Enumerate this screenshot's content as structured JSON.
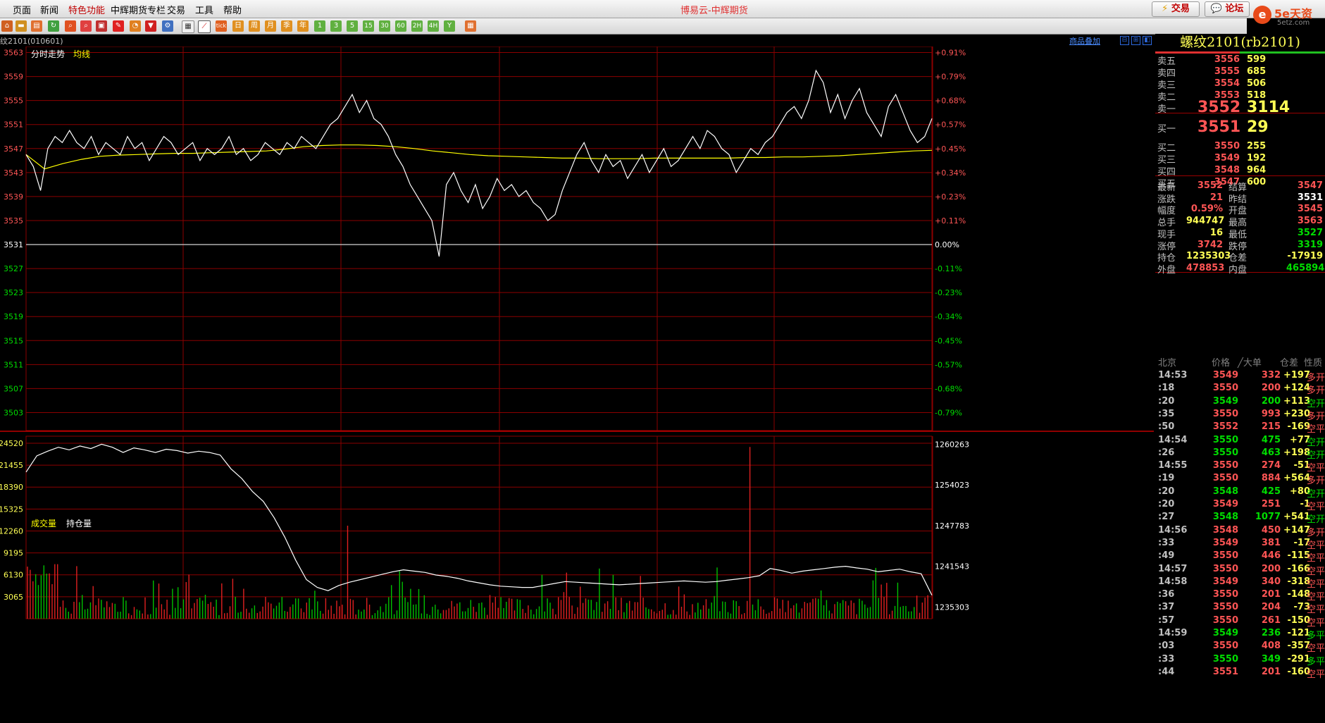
{
  "menubar": {
    "items": [
      "页面",
      "新闻",
      "特色功能",
      "中辉期货专栏",
      "交易",
      "工具",
      "帮助"
    ],
    "title": "博易云-中辉期货",
    "trade_button": "交易",
    "forum_button": "论坛",
    "logo_text": "5e天资",
    "logo_sub": "5etz.com"
  },
  "toolbar": {
    "icons": [
      "home-icon",
      "tag-icon",
      "book-icon",
      "refresh-icon",
      "search-icon",
      "zoom-out-icon",
      "window-icon",
      "pencil-icon",
      "palette-icon",
      "filter-icon",
      "settings-icon",
      "table-icon",
      "timeshare-icon",
      "tick-icon",
      "daily-icon",
      "weekly-icon",
      "monthly-icon",
      "quarterly-icon",
      "yearly-icon",
      "period-1-icon",
      "period-3-icon",
      "period-5-icon",
      "period-15-icon",
      "period-30-icon",
      "period-60-icon",
      "period-2h-icon",
      "period-4h-icon",
      "period-y-icon",
      "calendar-icon"
    ],
    "period_labels": [
      "tick",
      "日",
      "周",
      "月",
      "季",
      "年",
      "1",
      "3",
      "5",
      "15",
      "30",
      "60",
      "2H",
      "4H",
      "Y"
    ]
  },
  "chart_header": {
    "symbol_code": "纹2101(010601)",
    "overlay_link": "商品叠加",
    "price_title": "分时走势",
    "avg_title": "均线",
    "volume_title": "成交量",
    "oi_title": "持仓量"
  },
  "chart_data": [
    {
      "type": "line",
      "title": "分时走势",
      "series": [
        {
          "name": "分时走势",
          "color": "#ffffff"
        },
        {
          "name": "均线",
          "color": "#ffff00"
        }
      ],
      "reference_price": 3531,
      "ylim": [
        3500,
        3564
      ],
      "y_ticks": [
        3563,
        3559,
        3555,
        3551,
        3547,
        3543,
        3539,
        3535,
        3531,
        3527,
        3523,
        3519,
        3515,
        3511,
        3507,
        3503
      ],
      "pct_ticks": [
        "+0.91%",
        "+0.79%",
        "+0.68%",
        "+0.57%",
        "+0.45%",
        "+0.34%",
        "+0.23%",
        "+0.11%",
        "0.00%",
        "-0.11%",
        "-0.23%",
        "-0.34%",
        "-0.45%",
        "-0.57%",
        "-0.68%",
        "-0.79%"
      ],
      "price_values": [
        3546,
        3544,
        3540,
        3547,
        3549,
        3548,
        3550,
        3548,
        3547,
        3549,
        3546,
        3548,
        3547,
        3546,
        3549,
        3547,
        3548,
        3545,
        3547,
        3549,
        3548,
        3546,
        3547,
        3548,
        3545,
        3547,
        3546,
        3547,
        3549,
        3546,
        3547,
        3545,
        3546,
        3548,
        3547,
        3546,
        3548,
        3547,
        3549,
        3548,
        3547,
        3549,
        3551,
        3552,
        3554,
        3556,
        3553,
        3555,
        3552,
        3551,
        3549,
        3546,
        3544,
        3541,
        3539,
        3537,
        3535,
        3529,
        3541,
        3543,
        3540,
        3538,
        3541,
        3537,
        3539,
        3542,
        3540,
        3541,
        3539,
        3540,
        3538,
        3537,
        3535,
        3536,
        3540,
        3543,
        3546,
        3548,
        3545,
        3543,
        3546,
        3544,
        3545,
        3542,
        3544,
        3546,
        3543,
        3545,
        3547,
        3544,
        3545,
        3547,
        3549,
        3547,
        3550,
        3549,
        3547,
        3546,
        3543,
        3545,
        3547,
        3546,
        3548,
        3549,
        3551,
        3553,
        3554,
        3552,
        3555,
        3560,
        3558,
        3553,
        3556,
        3552,
        3555,
        3557,
        3553,
        3551,
        3549,
        3554,
        3556,
        3553,
        3550,
        3548,
        3549,
        3552
      ],
      "avg_values": [
        3546,
        3543.6,
        3544.5,
        3545.2,
        3545.7,
        3545.9,
        3546.0,
        3546.1,
        3546.2,
        3546.2,
        3546.3,
        3546.4,
        3546.5,
        3546.6,
        3546.9,
        3547.3,
        3547.5,
        3547.6,
        3547.6,
        3547.5,
        3547.3,
        3547.0,
        3546.6,
        3546.3,
        3546.0,
        3545.8,
        3545.7,
        3545.6,
        3545.5,
        3545.4,
        3545.4,
        3545.3,
        3545.3,
        3545.3,
        3545.4,
        3545.4,
        3545.4,
        3545.4,
        3545.4,
        3545.5,
        3545.5,
        3545.6,
        3545.6,
        3545.7,
        3545.8,
        3546.0,
        3546.2,
        3546.4,
        3546.6,
        3546.7
      ],
      "volume_axis": {
        "ylim": [
          0,
          25500
        ],
        "ticks": [
          24520,
          21455,
          18390,
          15325,
          12260,
          9195,
          6130,
          3065
        ]
      },
      "oi_axis": {
        "ylim": [
          1233500,
          1261500
        ],
        "ticks": [
          1260263,
          1254023,
          1247783,
          1241543,
          1235303
        ]
      },
      "oi_values": [
        1256000,
        1258500,
        1259200,
        1259800,
        1259400,
        1260000,
        1259600,
        1260263,
        1259800,
        1259000,
        1259700,
        1259400,
        1259000,
        1259500,
        1259300,
        1258900,
        1259200,
        1259000,
        1258600,
        1256500,
        1255000,
        1253000,
        1251500,
        1249000,
        1246000,
        1242500,
        1239500,
        1238300,
        1237800,
        1238600,
        1239100,
        1239500,
        1239900,
        1240300,
        1240700,
        1241000,
        1240800,
        1240600,
        1240200,
        1240000,
        1239700,
        1239300,
        1239000,
        1238700,
        1238500,
        1238400,
        1238300,
        1238300,
        1238600,
        1238900,
        1239200,
        1239100,
        1239000,
        1238900,
        1238800,
        1238700,
        1238800,
        1238900,
        1239000,
        1239100,
        1239200,
        1239300,
        1239200,
        1239100,
        1239200,
        1239400,
        1239600,
        1239800,
        1240100,
        1241200,
        1240900,
        1240500,
        1240800,
        1241000,
        1241200,
        1241400,
        1241543,
        1241300,
        1241100,
        1240700,
        1240900,
        1241100,
        1240700,
        1240400,
        1237100
      ]
    }
  ],
  "quote_panel": {
    "symbol": "螺纹2101(rb2101)",
    "asks": [
      {
        "label": "卖五",
        "price": "3556",
        "vol": "599"
      },
      {
        "label": "卖四",
        "price": "3555",
        "vol": "685"
      },
      {
        "label": "卖三",
        "price": "3554",
        "vol": "506"
      },
      {
        "label": "卖二",
        "price": "3553",
        "vol": "518"
      },
      {
        "label": "卖一",
        "price": "3552",
        "vol": "3114"
      }
    ],
    "bids": [
      {
        "label": "买一",
        "price": "3551",
        "vol": "29"
      },
      {
        "label": "买二",
        "price": "3550",
        "vol": "255"
      },
      {
        "label": "买三",
        "price": "3549",
        "vol": "192"
      },
      {
        "label": "买四",
        "price": "3548",
        "vol": "964"
      },
      {
        "label": "买五",
        "price": "3547",
        "vol": "600"
      }
    ],
    "stats": [
      {
        "k1": "最新",
        "v1": "3552",
        "c1": "#ff5555",
        "k2": "结算",
        "v2": "3547",
        "c2": "#ff5555"
      },
      {
        "k1": "涨跌",
        "v1": "21",
        "c1": "#ff5555",
        "k2": "昨结",
        "v2": "3531",
        "c2": "#ffffff"
      },
      {
        "k1": "幅度",
        "v1": "0.59%",
        "c1": "#ff5555",
        "k2": "开盘",
        "v2": "3545",
        "c2": "#ff5555"
      },
      {
        "k1": "总手",
        "v1": "944747",
        "c1": "#ffff55",
        "k2": "最高",
        "v2": "3563",
        "c2": "#ff5555"
      },
      {
        "k1": "现手",
        "v1": "16",
        "c1": "#ffff55",
        "k2": "最低",
        "v2": "3527",
        "c2": "#00dd00"
      },
      {
        "k1": "涨停",
        "v1": "3742",
        "c1": "#ff5555",
        "k2": "跌停",
        "v2": "3319",
        "c2": "#00dd00"
      },
      {
        "k1": "持仓",
        "v1": "1235303",
        "c1": "#ffff55",
        "k2": "仓差",
        "v2": "-17919",
        "c2": "#ffff55"
      },
      {
        "k1": "外盘",
        "v1": "478853",
        "c1": "#ff5555",
        "k2": "内盘",
        "v2": "465894",
        "c2": "#00dd00"
      }
    ],
    "trade_header": [
      "北京",
      "价格",
      "╱大单",
      "仓差",
      "性质"
    ],
    "trades": [
      {
        "t": "14:53",
        "p": "3549",
        "v": "332",
        "d": "+197",
        "n": "多开",
        "pc": "#ff5555",
        "nc": "#ff5555"
      },
      {
        "t": ":18",
        "p": "3550",
        "v": "200",
        "d": "+124",
        "n": "多开",
        "pc": "#ff5555",
        "nc": "#ff5555"
      },
      {
        "t": ":20",
        "p": "3549",
        "v": "200",
        "d": "+113",
        "n": "空开",
        "pc": "#00dd00",
        "nc": "#00dd00"
      },
      {
        "t": ":35",
        "p": "3550",
        "v": "993",
        "d": "+230",
        "n": "多开",
        "pc": "#ff5555",
        "nc": "#ff5555"
      },
      {
        "t": ":50",
        "p": "3552",
        "v": "215",
        "d": "-169",
        "n": "空平",
        "pc": "#ff5555",
        "nc": "#ff5555"
      },
      {
        "t": "14:54",
        "p": "3550",
        "v": "475",
        "d": "+77",
        "n": "空开",
        "pc": "#00dd00",
        "nc": "#00dd00"
      },
      {
        "t": ":26",
        "p": "3550",
        "v": "463",
        "d": "+198",
        "n": "空开",
        "pc": "#00dd00",
        "nc": "#00dd00"
      },
      {
        "t": "14:55",
        "p": "3550",
        "v": "274",
        "d": "-51",
        "n": "空平",
        "pc": "#ff5555",
        "nc": "#ff5555"
      },
      {
        "t": ":19",
        "p": "3550",
        "v": "884",
        "d": "+564",
        "n": "多开",
        "pc": "#ff5555",
        "nc": "#ff5555"
      },
      {
        "t": ":20",
        "p": "3548",
        "v": "425",
        "d": "+80",
        "n": "空开",
        "pc": "#00dd00",
        "nc": "#00dd00"
      },
      {
        "t": ":20",
        "p": "3549",
        "v": "251",
        "d": "-1",
        "n": "空平",
        "pc": "#ff5555",
        "nc": "#ff5555"
      },
      {
        "t": ":27",
        "p": "3548",
        "v": "1077",
        "d": "+541",
        "n": "空开",
        "pc": "#00dd00",
        "nc": "#00dd00"
      },
      {
        "t": "14:56",
        "p": "3548",
        "v": "450",
        "d": "+147",
        "n": "多开",
        "pc": "#ff5555",
        "nc": "#ff5555"
      },
      {
        "t": ":33",
        "p": "3549",
        "v": "381",
        "d": "-17",
        "n": "空平",
        "pc": "#ff5555",
        "nc": "#ff5555"
      },
      {
        "t": ":49",
        "p": "3550",
        "v": "446",
        "d": "-115",
        "n": "空平",
        "pc": "#ff5555",
        "nc": "#ff5555"
      },
      {
        "t": "14:57",
        "p": "3550",
        "v": "200",
        "d": "-166",
        "n": "空平",
        "pc": "#ff5555",
        "nc": "#ff5555"
      },
      {
        "t": "14:58",
        "p": "3549",
        "v": "340",
        "d": "-318",
        "n": "空平",
        "pc": "#ff5555",
        "nc": "#ff5555"
      },
      {
        "t": ":36",
        "p": "3550",
        "v": "201",
        "d": "-148",
        "n": "空平",
        "pc": "#ff5555",
        "nc": "#ff5555"
      },
      {
        "t": ":37",
        "p": "3550",
        "v": "204",
        "d": "-73",
        "n": "空平",
        "pc": "#ff5555",
        "nc": "#ff5555"
      },
      {
        "t": ":57",
        "p": "3550",
        "v": "261",
        "d": "-150",
        "n": "空平",
        "pc": "#ff5555",
        "nc": "#ff5555"
      },
      {
        "t": "14:59",
        "p": "3549",
        "v": "236",
        "d": "-121",
        "n": "多平",
        "pc": "#00dd00",
        "nc": "#00dd00"
      },
      {
        "t": ":03",
        "p": "3550",
        "v": "408",
        "d": "-357",
        "n": "空平",
        "pc": "#ff5555",
        "nc": "#ff5555"
      },
      {
        "t": ":33",
        "p": "3550",
        "v": "349",
        "d": "-291",
        "n": "多平",
        "pc": "#00dd00",
        "nc": "#00dd00"
      },
      {
        "t": ":44",
        "p": "3551",
        "v": "201",
        "d": "-160",
        "n": "空平",
        "pc": "#ff5555",
        "nc": "#ff5555"
      }
    ]
  },
  "colors": {
    "grid": "#8b0000",
    "up": "#ff5555",
    "down": "#00dd00",
    "avg": "#ffff00",
    "price": "#ffffff",
    "text": "#c0c0c0"
  }
}
